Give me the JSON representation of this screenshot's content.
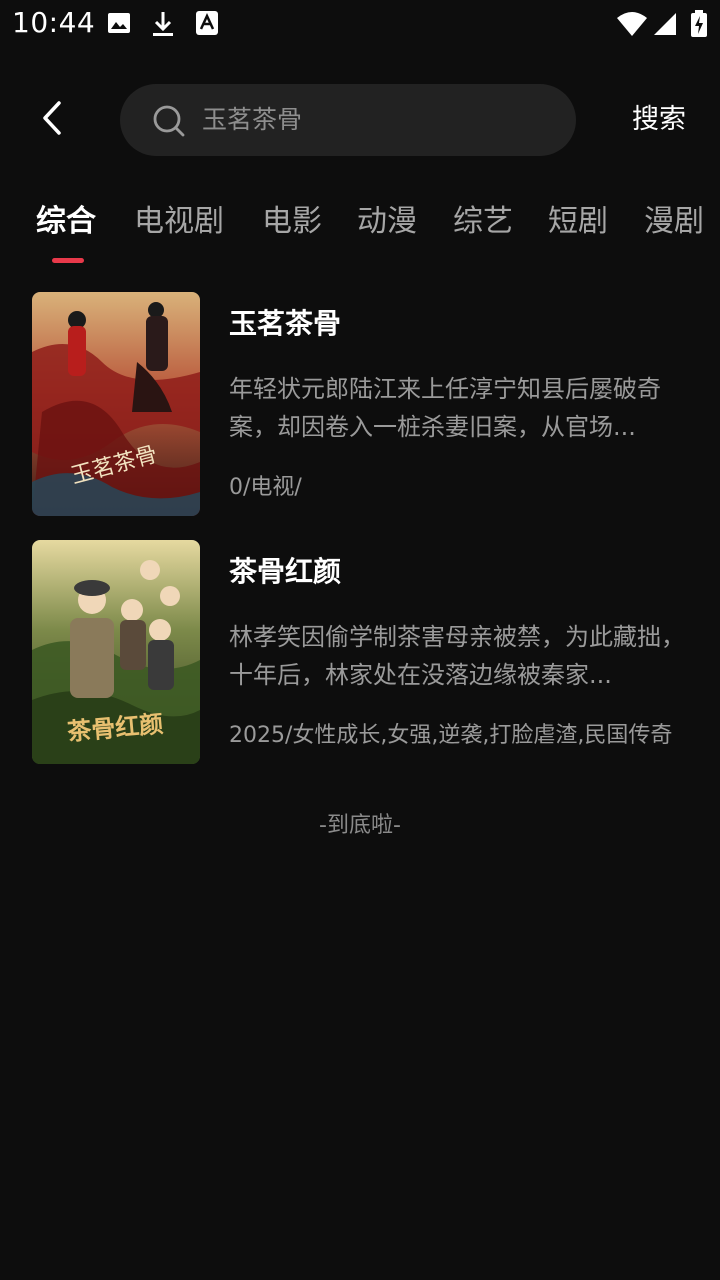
{
  "status_bar": {
    "time": "10:44",
    "icons": [
      "image-icon",
      "download-icon",
      "keyboard-a-icon",
      "wifi-icon",
      "signal-icon",
      "battery-charging-icon"
    ]
  },
  "search": {
    "query": "玉茗茶骨",
    "button_label": "搜索"
  },
  "tabs": [
    {
      "label": "综合",
      "active": true
    },
    {
      "label": "电视剧",
      "active": false
    },
    {
      "label": "电影",
      "active": false
    },
    {
      "label": "动漫",
      "active": false
    },
    {
      "label": "综艺",
      "active": false
    },
    {
      "label": "短剧",
      "active": false
    },
    {
      "label": "漫剧",
      "active": false
    }
  ],
  "colors": {
    "background": "#0d0d0d",
    "accent": "#e8394a",
    "search_bg": "#222222",
    "muted_text": "#9a9a9a"
  },
  "results": [
    {
      "title": "玉茗茶骨",
      "description": "年轻状元郎陆江来上任淳宁知县后屡破奇案，却因卷入一桩杀妻旧案，从官场...",
      "meta": "0/电视/",
      "poster_caption": "玉茗茶骨"
    },
    {
      "title": "茶骨红颜",
      "description": "林孝笑因偷学制茶害母亲被禁，为此藏拙，十年后，林家处在没落边缘被秦家...",
      "meta": "2025/女性成长,女强,逆袭,打脸虐渣,民国传奇",
      "poster_caption": "茶骨红颜"
    }
  ],
  "footer": {
    "end_text": "-到底啦-"
  }
}
